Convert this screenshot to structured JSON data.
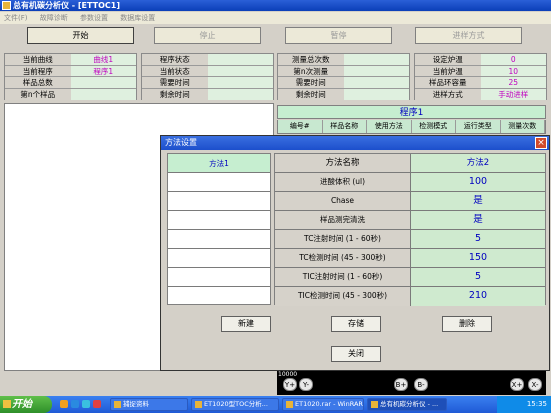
{
  "window": {
    "title": "总有机碳分析仪 - [ETTOC1]"
  },
  "menu": [
    "文件(F)",
    "故障诊断",
    "参数设置",
    "数据库设置"
  ],
  "toolbar": {
    "start": "开始",
    "stop": "停止",
    "pause": "暂停",
    "mode": "进样方式"
  },
  "info1": {
    "rows": [
      {
        "label": "当前曲线",
        "value": "曲线1"
      },
      {
        "label": "当前程序",
        "value": "程序1"
      },
      {
        "label": "样品总数",
        "value": ""
      },
      {
        "label": "第n个样品",
        "value": ""
      }
    ]
  },
  "info2": {
    "rows": [
      {
        "label": "程序状态",
        "value": ""
      },
      {
        "label": "当前状态",
        "value": ""
      },
      {
        "label": "需要时间",
        "value": ""
      },
      {
        "label": "剩余时间",
        "value": ""
      }
    ]
  },
  "info3": {
    "rows": [
      {
        "label": "测量总次数",
        "value": ""
      },
      {
        "label": "第n次测量",
        "value": ""
      },
      {
        "label": "需要时间",
        "value": ""
      },
      {
        "label": "剩余时间",
        "value": ""
      }
    ]
  },
  "info4": {
    "rows": [
      {
        "label": "设定炉温",
        "value": "0"
      },
      {
        "label": "当前炉温",
        "value": "10"
      },
      {
        "label": "样品环容量",
        "value": "25"
      },
      {
        "label": "进样方式",
        "value": "手动进样"
      }
    ]
  },
  "program": {
    "title": "程序1",
    "headers": [
      "编号#",
      "样品名称",
      "使用方法",
      "检测模式",
      "运行类型",
      "测量次数"
    ]
  },
  "dialog": {
    "title": "方法设置",
    "methods": [
      "方法1"
    ],
    "param_header": {
      "label": "方法名称",
      "value": "方法2"
    },
    "params": [
      {
        "label": "进酸体积 (ul)",
        "value": "100"
      },
      {
        "label": "Chase",
        "value": "是"
      },
      {
        "label": "样品测完清洗",
        "value": "是"
      },
      {
        "label": "TC注射时间 (1 - 60秒)",
        "value": "5"
      },
      {
        "label": "TC检测时间 (45 - 300秒)",
        "value": "150"
      },
      {
        "label": "TIC注射时间 (1 - 60秒)",
        "value": "5"
      },
      {
        "label": "TIC检测时间 (45 - 300秒)",
        "value": "210"
      }
    ],
    "buttons": {
      "new": "新建",
      "save": "存储",
      "delete": "删除",
      "close": "关闭"
    }
  },
  "chart_strip": {
    "label": "10000",
    "buttons": [
      "Y+",
      "Y-",
      "B+",
      "B-",
      "X+",
      "X-"
    ]
  },
  "taskbar": {
    "start": "开始",
    "tasks": [
      "捕捉资料",
      "ET1020型TOC分析...",
      "ET1020.rar - WinRAR",
      "总有机碳分析仪 - ..."
    ],
    "clock": "15:35"
  }
}
